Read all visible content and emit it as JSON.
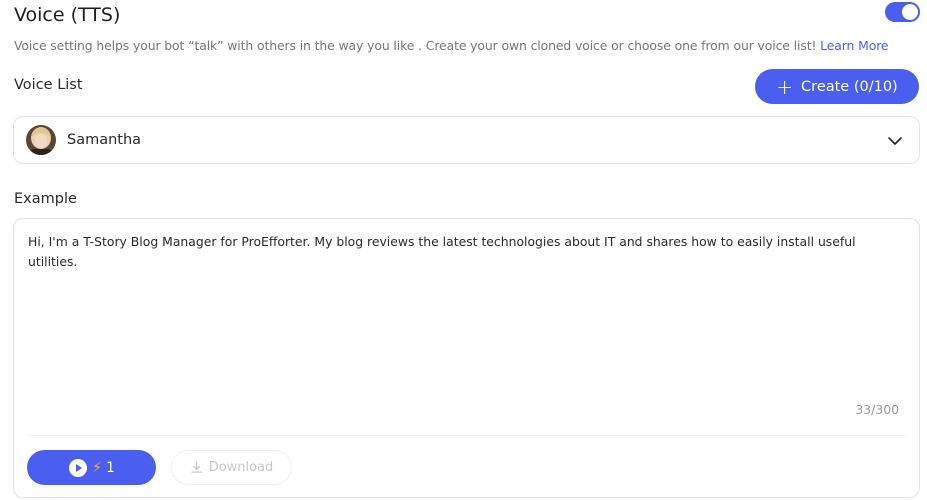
{
  "header": {
    "title": "Voice (TTS)",
    "toggle_on": true,
    "description": "Voice setting helps your bot “talk” with others in the way you like . Create your own cloned voice or choose one from our voice list!",
    "learn_more": "Learn More"
  },
  "voice_list": {
    "label": "Voice List",
    "create_label": "Create (0/10)",
    "selected_voice": "Samantha"
  },
  "example": {
    "label": "Example",
    "text": "Hi, I'm a T-Story Blog Manager for ProEfforter. My blog reviews the latest technologies about IT and shares how to easily install useful utilities.",
    "counter": "33/300",
    "play_cost": "1",
    "download_label": "Download"
  },
  "colors": {
    "accent": "#4a5ff0",
    "bolt": "#f6b431"
  }
}
